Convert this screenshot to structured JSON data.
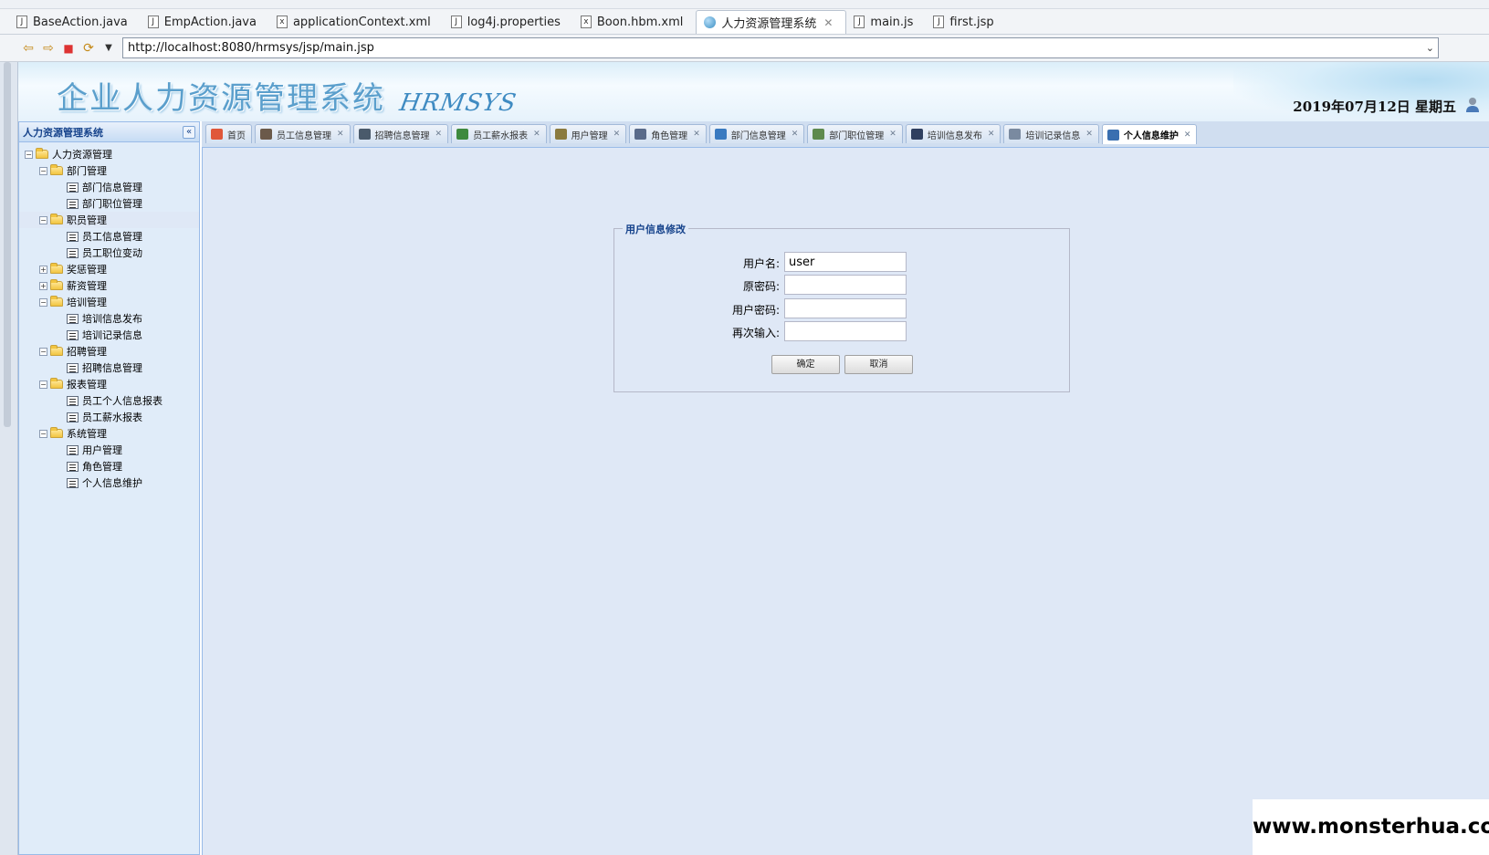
{
  "editor_tabs": [
    {
      "label": "BaseAction.java",
      "icon": "java-file-icon"
    },
    {
      "label": "EmpAction.java",
      "icon": "java-file-icon"
    },
    {
      "label": "applicationContext.xml",
      "icon": "xml-file-icon"
    },
    {
      "label": "log4j.properties",
      "icon": "properties-file-icon"
    },
    {
      "label": "Boon.hbm.xml",
      "icon": "xml-file-icon"
    },
    {
      "label": "人力资源管理系统",
      "icon": "globe-icon",
      "active": true
    },
    {
      "label": "main.js",
      "icon": "js-file-icon"
    },
    {
      "label": "first.jsp",
      "icon": "jsp-file-icon"
    }
  ],
  "browser": {
    "url": "http://localhost:8080/hrmsys/jsp/main.jsp"
  },
  "banner": {
    "title": "企业人力资源管理系统",
    "subtitle": "HRMSYS",
    "date": "2019年07月12日 星期五"
  },
  "sidebar": {
    "title": "人力资源管理系统",
    "tree": [
      {
        "label": "人力资源管理",
        "level": 0,
        "type": "folder",
        "toggle": "−"
      },
      {
        "label": "部门管理",
        "level": 1,
        "type": "folder",
        "toggle": "−"
      },
      {
        "label": "部门信息管理",
        "level": 2,
        "type": "leaf"
      },
      {
        "label": "部门职位管理",
        "level": 2,
        "type": "leaf"
      },
      {
        "label": "职员管理",
        "level": 1,
        "type": "folder",
        "toggle": "−",
        "selected": true
      },
      {
        "label": "员工信息管理",
        "level": 2,
        "type": "leaf"
      },
      {
        "label": "员工职位变动",
        "level": 2,
        "type": "leaf"
      },
      {
        "label": "奖惩管理",
        "level": 1,
        "type": "folder",
        "toggle": "+"
      },
      {
        "label": "薪资管理",
        "level": 1,
        "type": "folder",
        "toggle": "+"
      },
      {
        "label": "培训管理",
        "level": 1,
        "type": "folder",
        "toggle": "−"
      },
      {
        "label": "培训信息发布",
        "level": 2,
        "type": "leaf"
      },
      {
        "label": "培训记录信息",
        "level": 2,
        "type": "leaf"
      },
      {
        "label": "招聘管理",
        "level": 1,
        "type": "folder",
        "toggle": "−"
      },
      {
        "label": "招聘信息管理",
        "level": 2,
        "type": "leaf"
      },
      {
        "label": "报表管理",
        "level": 1,
        "type": "folder",
        "toggle": "−"
      },
      {
        "label": "员工个人信息报表",
        "level": 2,
        "type": "leaf"
      },
      {
        "label": "员工薪水报表",
        "level": 2,
        "type": "leaf"
      },
      {
        "label": "系统管理",
        "level": 1,
        "type": "folder",
        "toggle": "−"
      },
      {
        "label": "用户管理",
        "level": 2,
        "type": "leaf"
      },
      {
        "label": "角色管理",
        "level": 2,
        "type": "leaf"
      },
      {
        "label": "个人信息维护",
        "level": 2,
        "type": "leaf"
      }
    ]
  },
  "page_tabs": [
    {
      "label": "首页",
      "icon": "home-icon",
      "color": "#e0573a",
      "closable": false
    },
    {
      "label": "员工信息管理",
      "icon": "person-icon",
      "color": "#6b5a4a",
      "closable": true
    },
    {
      "label": "招聘信息管理",
      "icon": "list-icon",
      "color": "#4a5a6b",
      "closable": true
    },
    {
      "label": "员工薪水报表",
      "icon": "yen-icon",
      "color": "#3e8a3e",
      "closable": true
    },
    {
      "label": "用户管理",
      "icon": "user-card-icon",
      "color": "#8a7a3e",
      "closable": true
    },
    {
      "label": "角色管理",
      "icon": "person-icon",
      "color": "#5a6b8a",
      "closable": true
    },
    {
      "label": "部门信息管理",
      "icon": "monitor-icon",
      "color": "#3a7ac0",
      "closable": true
    },
    {
      "label": "部门职位管理",
      "icon": "grid-icon",
      "color": "#5e8a4e",
      "closable": true
    },
    {
      "label": "培训信息发布",
      "icon": "lines-icon",
      "color": "#2f3f5f",
      "closable": true
    },
    {
      "label": "培训记录信息",
      "icon": "table-icon",
      "color": "#7a8aa0",
      "closable": true
    },
    {
      "label": "个人信息维护",
      "icon": "edit-user-icon",
      "color": "#3a6fb0",
      "closable": true,
      "active": true
    }
  ],
  "form": {
    "legend": "用户信息修改",
    "username_label": "用户名:",
    "username_value": "user",
    "old_password_label": "原密码:",
    "new_password_label": "用户密码:",
    "confirm_label": "再次输入:",
    "ok_label": "确定",
    "cancel_label": "取消"
  },
  "watermark": "www.monsterhua.com"
}
